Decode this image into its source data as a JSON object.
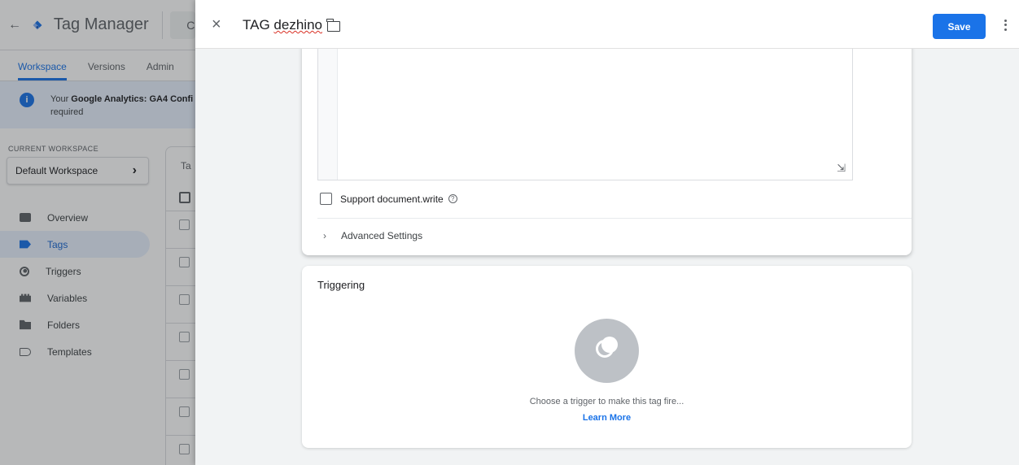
{
  "app": {
    "back_icon": "arrow-left-icon",
    "name": "Tag Manager",
    "logo": "gtm-diamond-icon",
    "colors": {
      "brand_blue": "#1a73e8",
      "brand_dark": "#246fdb"
    },
    "partial_chip": "C"
  },
  "top_tabs": [
    {
      "label": "Workspace",
      "active": true
    },
    {
      "label": "Versions",
      "active": false
    },
    {
      "label": "Admin",
      "active": false
    }
  ],
  "alert": {
    "icon": "info-icon",
    "prefix": "Your ",
    "bold": "Google Analytics: GA4 Confi",
    "line2": "required"
  },
  "workspace": {
    "label": "CURRENT WORKSPACE",
    "name": "Default Workspace",
    "chevron": "›"
  },
  "sidebar": {
    "items": [
      {
        "label": "Overview",
        "icon": "overview-icon",
        "active": false
      },
      {
        "label": "Tags",
        "icon": "tag-icon",
        "active": true
      },
      {
        "label": "Triggers",
        "icon": "trigger-icon",
        "active": false
      },
      {
        "label": "Variables",
        "icon": "variables-icon",
        "active": false
      },
      {
        "label": "Folders",
        "icon": "folder-icon",
        "active": false
      },
      {
        "label": "Templates",
        "icon": "template-icon",
        "active": false
      }
    ]
  },
  "list": {
    "header": "Ta"
  },
  "editor": {
    "close": "×",
    "title_prefix": "TAG ",
    "title_word": "dezhino",
    "save_label": "Save",
    "more_icon": "more-vert-icon",
    "support_doc_write": "Support document.write",
    "support_doc_write_checked": false,
    "help_glyph": "?",
    "advanced_settings": "Advanced Settings",
    "advanced_chevron": "›",
    "resize_glyph": "⇲"
  },
  "triggering": {
    "title": "Triggering",
    "empty_message": "Choose a trigger to make this tag fire...",
    "learn_more": "Learn More",
    "icon": "trigger-empty-icon"
  }
}
